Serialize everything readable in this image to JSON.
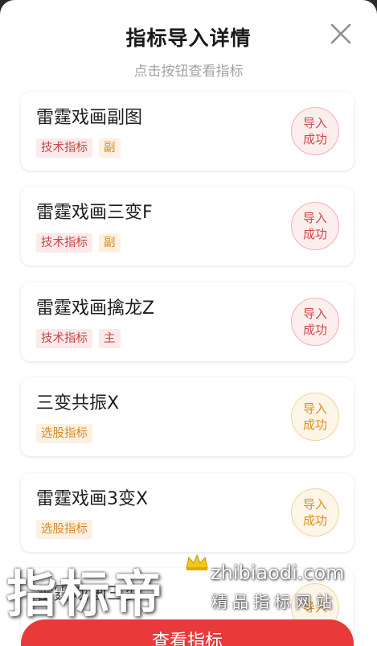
{
  "modal": {
    "title": "指标导入详情",
    "subtitle": "点击按钮查看指标"
  },
  "items": [
    {
      "name": "雷霆戏画副图",
      "tags": [
        "技术指标",
        "副"
      ],
      "status_line1": "导入",
      "status_line2": "成功",
      "tone": "red"
    },
    {
      "name": "雷霆戏画三变F",
      "tags": [
        "技术指标",
        "副"
      ],
      "status_line1": "导入",
      "status_line2": "成功",
      "tone": "red"
    },
    {
      "name": "雷霆戏画擒龙Z",
      "tags": [
        "技术指标",
        "主"
      ],
      "status_line1": "导入",
      "status_line2": "成功",
      "tone": "red"
    },
    {
      "name": "三变共振X",
      "tags": [
        "选股指标"
      ],
      "status_line1": "导入",
      "status_line2": "成功",
      "tone": "orange"
    },
    {
      "name": "雷霆戏画3变X",
      "tags": [
        "选股指标"
      ],
      "status_line1": "导入",
      "status_line2": "成功",
      "tone": "orange"
    },
    {
      "name": "雷霆戏画三变",
      "tags": [],
      "status_line1": "导入",
      "status_line2": "",
      "tone": "orange"
    }
  ],
  "watermark": {
    "big_text": "指标帝",
    "url": "zhibiaodi.com",
    "slogan": "精品指标网站"
  },
  "button": {
    "label": "查看指标"
  },
  "colors": {
    "accent_red": "#e83a3a",
    "tag_red": "#c6484a",
    "tag_orange": "#d98a28"
  }
}
